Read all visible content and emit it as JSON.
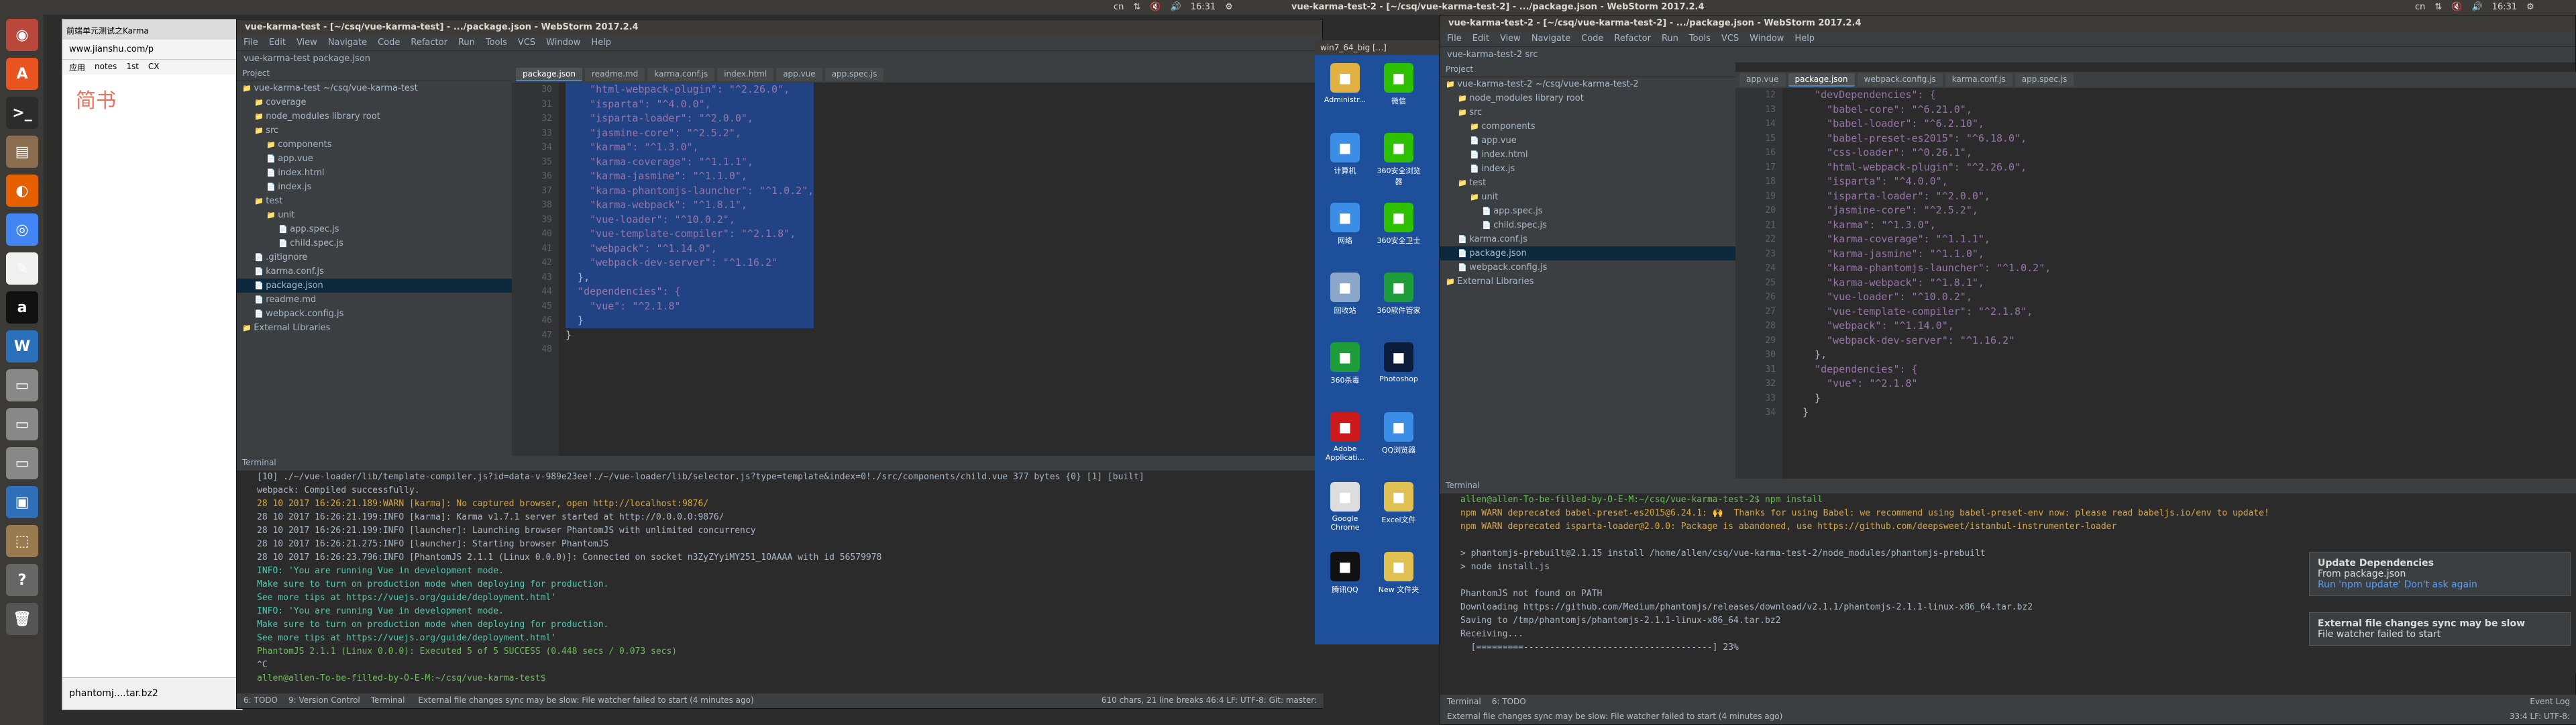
{
  "topbar": {
    "right_window_title": "vue-karma-test-2 - [~/csq/vue-karma-test-2] - .../package.json - WebStorm 2017.2.4",
    "tray_left": [
      "cn",
      "⇅",
      "🔇",
      "🔊",
      "16:31",
      "⚙"
    ],
    "tray_right": [
      "cn",
      "⇅",
      "🔇",
      "🔊",
      "16:31",
      "⚙"
    ]
  },
  "launcher": {
    "icons": [
      {
        "name": "dash-icon",
        "glyph": "◉",
        "color": "#b9473c"
      },
      {
        "name": "ubuntu-icon",
        "glyph": "A",
        "color": "#e95420"
      },
      {
        "name": "terminal-icon",
        "glyph": ">_",
        "color": "#2c2c2c"
      },
      {
        "name": "files-icon",
        "glyph": "▤",
        "color": "#8b6d4f"
      },
      {
        "name": "firefox-icon",
        "glyph": "◐",
        "color": "#e66000"
      },
      {
        "name": "chrome-icon",
        "glyph": "◎",
        "color": "#4285f4"
      },
      {
        "name": "text-editor-icon",
        "glyph": "✎",
        "color": "#f0f0f0"
      },
      {
        "name": "amazon-icon",
        "glyph": "a",
        "color": "#111111"
      },
      {
        "name": "writer-icon",
        "glyph": "W",
        "color": "#2a6fba"
      },
      {
        "name": "drive-icon",
        "glyph": "▭",
        "color": "#888888"
      },
      {
        "name": "drive-icon-2",
        "glyph": "▭",
        "color": "#888888"
      },
      {
        "name": "drive-icon-3",
        "glyph": "▭",
        "color": "#888888"
      },
      {
        "name": "virtualbox-icon",
        "glyph": "▣",
        "color": "#2f6fb7"
      },
      {
        "name": "software-center-icon",
        "glyph": "⬚",
        "color": "#9a7b4f"
      },
      {
        "name": "help-icon",
        "glyph": "?",
        "color": "#666666"
      },
      {
        "name": "trash-icon",
        "glyph": "🗑",
        "color": "#555555"
      }
    ]
  },
  "browser": {
    "tab_label": "前端单元测试之Karma",
    "url": "www.jianshu.com/p",
    "bookmarks": [
      "应用",
      "notes",
      "1st",
      "CX"
    ],
    "brand": "简书",
    "download_label": "phantomj....tar.bz2"
  },
  "left_ide": {
    "title": "vue-karma-test - [~/csq/vue-karma-test] - .../package.json - WebStorm 2017.2.4",
    "menu": [
      "File",
      "Edit",
      "View",
      "Navigate",
      "Code",
      "Refactor",
      "Run",
      "Tools",
      "VCS",
      "Window",
      "Help"
    ],
    "breadcrumb": "vue-karma-test  package.json",
    "tabs": [
      "package.json",
      "readme.md",
      "karma.conf.js",
      "index.html",
      "app.vue",
      "app.spec.js"
    ],
    "project_header": "Project",
    "tree": [
      {
        "label": "vue-karma-test  ~/csq/vue-karma-test",
        "indent": 0
      },
      {
        "label": "coverage",
        "indent": 1
      },
      {
        "label": "node_modules  library root",
        "indent": 1
      },
      {
        "label": "src",
        "indent": 1
      },
      {
        "label": "components",
        "indent": 2
      },
      {
        "label": "app.vue",
        "indent": 2
      },
      {
        "label": "index.html",
        "indent": 2
      },
      {
        "label": "index.js",
        "indent": 2
      },
      {
        "label": "test",
        "indent": 1
      },
      {
        "label": "unit",
        "indent": 2
      },
      {
        "label": "app.spec.js",
        "indent": 3
      },
      {
        "label": "child.spec.js",
        "indent": 3
      },
      {
        "label": ".gitignore",
        "indent": 1
      },
      {
        "label": "karma.conf.js",
        "indent": 1
      },
      {
        "label": "package.json",
        "indent": 1
      },
      {
        "label": "readme.md",
        "indent": 1
      },
      {
        "label": "webpack.config.js",
        "indent": 1
      },
      {
        "label": "External Libraries",
        "indent": 0
      }
    ],
    "line_numbers": [
      "30",
      "31",
      "32",
      "33",
      "34",
      "35",
      "36",
      "37",
      "38",
      "39",
      "40",
      "41",
      "42",
      "43",
      "44",
      "45",
      "46",
      "47",
      "48"
    ],
    "code": [
      "    \"html-webpack-plugin\": \"^2.26.0\",",
      "    \"isparta\": \"^4.0.0\",",
      "    \"isparta-loader\": \"^2.0.0\",",
      "    \"jasmine-core\": \"^2.5.2\",",
      "    \"karma\": \"^1.3.0\",",
      "    \"karma-coverage\": \"^1.1.1\",",
      "    \"karma-jasmine\": \"^1.1.0\",",
      "    \"karma-phantomjs-launcher\": \"^1.0.2\",",
      "    \"karma-webpack\": \"^1.8.1\",",
      "    \"vue-loader\": \"^10.0.2\",",
      "    \"vue-template-compiler\": \"^2.1.8\",",
      "    \"webpack\": \"^1.14.0\",",
      "    \"webpack-dev-server\": \"^1.16.2\"",
      "  },",
      "  \"dependencies\": {",
      "    \"vue\": \"^2.1.8\"",
      "  }",
      "}",
      ""
    ],
    "terminal_header": "Terminal",
    "terminal_lines": [
      "[10] ./~/vue-loader/lib/template-compiler.js?id=data-v-989e23ee!./~/vue-loader/lib/selector.js?type=template&index=0!./src/components/child.vue 377 bytes {0} [1] [built]",
      "webpack: Compiled successfully.",
      "28 10 2017 16:26:21.189:WARN [karma]: No captured browser, open http://localhost:9876/",
      "28 10 2017 16:26:21.199:INFO [karma]: Karma v1.7.1 server started at http://0.0.0.0:9876/",
      "28 10 2017 16:26:21.199:INFO [launcher]: Launching browser PhantomJS with unlimited concurrency",
      "28 10 2017 16:26:21.275:INFO [launcher]: Starting browser PhantomJS",
      "28 10 2017 16:26:23.796:INFO [PhantomJS 2.1.1 (Linux 0.0.0)]: Connected on socket n3ZyZYyiMY251_1OAAAA with id 56579978",
      "INFO: 'You are running Vue in development mode.",
      "Make sure to turn on production mode when deploying for production.",
      "See more tips at https://vuejs.org/guide/deployment.html'",
      "INFO: 'You are running Vue in development mode.",
      "Make sure to turn on production mode when deploying for production.",
      "See more tips at https://vuejs.org/guide/deployment.html'",
      "PhantomJS 2.1.1 (Linux 0.0.0): Executed 5 of 5 SUCCESS (0.448 secs / 0.073 secs)",
      "^C",
      "allen@allen-To-be-filled-by-O-E-M:~/csq/vue-karma-test$ "
    ],
    "bottom_tabs": [
      "6: TODO",
      "9: Version Control",
      "Terminal"
    ],
    "status_left": "External file changes sync may be slow: File watcher failed to start (4 minutes ago)",
    "status_right": "610 chars, 21 line breaks    46:4  LF:  UTF-8:  Git: master:"
  },
  "desktop": {
    "title": "win7_64_big [...]",
    "icons": [
      {
        "label": "Administr...",
        "color": "#e0b040"
      },
      {
        "label": "微信",
        "color": "#2dc100"
      },
      {
        "label": "计算机",
        "color": "#3a8ee6"
      },
      {
        "label": "360安全浏览器",
        "color": "#2dc100"
      },
      {
        "label": "网络",
        "color": "#3a8ee6"
      },
      {
        "label": "360安全卫士",
        "color": "#2dc100"
      },
      {
        "label": "回收站",
        "color": "#8aa6c8"
      },
      {
        "label": "360软件管家",
        "color": "#1e9e3a"
      },
      {
        "label": "360杀毒",
        "color": "#1e9e3a"
      },
      {
        "label": "Photoshop",
        "color": "#0b1b3a"
      },
      {
        "label": "Adobe Applicati...",
        "color": "#cc1a1a"
      },
      {
        "label": "QQ浏览器",
        "color": "#3a8ee6"
      },
      {
        "label": "Google Chrome",
        "color": "#dddddd"
      },
      {
        "label": "Excel文件",
        "color": "#e0c050"
      },
      {
        "label": "腾讯QQ",
        "color": "#111111"
      },
      {
        "label": "New 文件夹",
        "color": "#e0c050"
      }
    ]
  },
  "right_ide": {
    "title": "vue-karma-test-2 - [~/csq/vue-karma-test-2] - .../package.json - WebStorm 2017.2.4",
    "menu": [
      "File",
      "Edit",
      "View",
      "Navigate",
      "Code",
      "Refactor",
      "Run",
      "Tools",
      "VCS",
      "Window",
      "Help"
    ],
    "breadcrumb": "vue-karma-test-2  src",
    "tabs": [
      "app.vue",
      "package.json",
      "webpack.config.js",
      "karma.conf.js",
      "app.spec.js"
    ],
    "project_header": "Project",
    "tree": [
      {
        "label": "vue-karma-test-2  ~/csq/vue-karma-test-2",
        "indent": 0
      },
      {
        "label": "node_modules  library root",
        "indent": 1
      },
      {
        "label": "src",
        "indent": 1
      },
      {
        "label": "components",
        "indent": 2
      },
      {
        "label": "app.vue",
        "indent": 2
      },
      {
        "label": "index.html",
        "indent": 2
      },
      {
        "label": "index.js",
        "indent": 2
      },
      {
        "label": "test",
        "indent": 1
      },
      {
        "label": "unit",
        "indent": 2
      },
      {
        "label": "app.spec.js",
        "indent": 3
      },
      {
        "label": "child.spec.js",
        "indent": 3
      },
      {
        "label": "karma.conf.js",
        "indent": 1
      },
      {
        "label": "package.json",
        "indent": 1
      },
      {
        "label": "webpack.config.js",
        "indent": 1
      },
      {
        "label": "External Libraries",
        "indent": 0
      }
    ],
    "line_numbers": [
      "12",
      "13",
      "14",
      "15",
      "16",
      "17",
      "18",
      "19",
      "20",
      "21",
      "22",
      "23",
      "24",
      "25",
      "26",
      "27",
      "28",
      "29",
      "30",
      "31",
      "32",
      "33",
      "34"
    ],
    "code": [
      "  \"devDependencies\": {",
      "    \"babel-core\": \"^6.21.0\",",
      "    \"babel-loader\": \"^6.2.10\",",
      "    \"babel-preset-es2015\": \"^6.18.0\",",
      "    \"css-loader\": \"^0.26.1\",",
      "    \"html-webpack-plugin\": \"^2.26.0\",",
      "    \"isparta\": \"^4.0.0\",",
      "    \"isparta-loader\": \"^2.0.0\",",
      "    \"jasmine-core\": \"^2.5.2\",",
      "    \"karma\": \"^1.3.0\",",
      "    \"karma-coverage\": \"^1.1.1\",",
      "    \"karma-jasmine\": \"^1.1.0\",",
      "    \"karma-phantomjs-launcher\": \"^1.0.2\",",
      "    \"karma-webpack\": \"^1.8.1\",",
      "    \"vue-loader\": \"^10.0.2\",",
      "    \"vue-template-compiler\": \"^2.1.8\",",
      "    \"webpack\": \"^1.14.0\",",
      "    \"webpack-dev-server\": \"^1.16.2\"",
      "  },",
      "  \"dependencies\": {",
      "    \"vue\": \"^2.1.8\"",
      "  }",
      "}"
    ],
    "terminal_header": "Terminal",
    "terminal_lines": [
      "allen@allen-To-be-filled-by-O-E-M:~/csq/vue-karma-test-2$ npm install",
      "npm WARN deprecated babel-preset-es2015@6.24.1: 🙌  Thanks for using Babel: we recommend using babel-preset-env now: please read babeljs.io/env to update!",
      "npm WARN deprecated isparta-loader@2.0.0: Package is abandoned, use https://github.com/deepsweet/istanbul-instrumenter-loader",
      "",
      "> phantomjs-prebuilt@2.1.15 install /home/allen/csq/vue-karma-test-2/node_modules/phantomjs-prebuilt",
      "> node install.js",
      "",
      "PhantomJS not found on PATH",
      "Downloading https://github.com/Medium/phantomjs/releases/download/v2.1.1/phantomjs-2.1.1-linux-x86_64.tar.bz2",
      "Saving to /tmp/phantomjs/phantomjs-2.1.1-linux-x86_64.tar.bz2",
      "Receiving...",
      "  [=========------------------------------------] 23%"
    ],
    "bottom_tabs": [
      "Terminal",
      "6: TODO"
    ],
    "status_left": "External file changes sync may be slow: File watcher failed to start (4 minutes ago)",
    "status_right": "33:4  LF:  UTF-8:"
  },
  "notifications": [
    {
      "title": "Update Dependencies",
      "body": "From package.json",
      "links": "Run 'npm update'   Don't ask again"
    },
    {
      "title": "External file changes sync may be slow",
      "body": "File watcher failed to start",
      "links": ""
    }
  ],
  "event_log_label": "Event Log"
}
